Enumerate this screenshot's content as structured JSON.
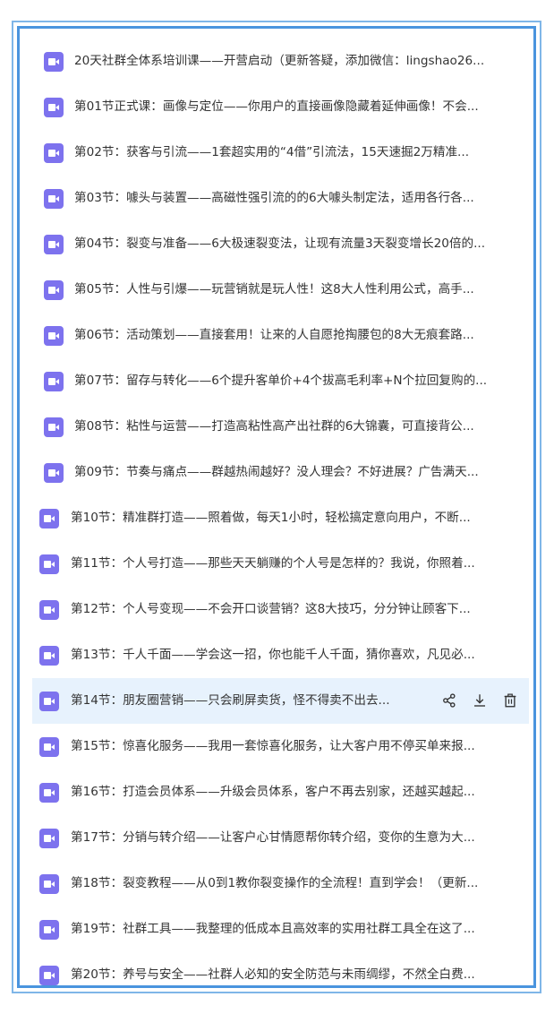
{
  "lessons": [
    {
      "title": "20天社群全体系培训课——开营启动（更新答疑，添加微信：lingshao26..."
    },
    {
      "title": "第01节正式课：画像与定位——你用户的直接画像隐藏着延伸画像！不会..."
    },
    {
      "title": "第02节：获客与引流——1套超实用的“4借”引流法，15天速掘2万精准..."
    },
    {
      "title": "第03节：噱头与装置——高磁性强引流的的6大噱头制定法，适用各行各..."
    },
    {
      "title": "第04节：裂变与准备——6大极速裂变法，让现有流量3天裂变增长20倍的..."
    },
    {
      "title": "第05节：人性与引爆——玩营销就是玩人性！这8大人性利用公式，高手..."
    },
    {
      "title": "第06节：活动策划——直接套用！让来的人自愿抢掏腰包的8大无痕套路..."
    },
    {
      "title": "第07节：留存与转化——6个提升客单价+4个拔高毛利率+N个拉回复购的..."
    },
    {
      "title": "第08节：粘性与运营——打造高粘性高产出社群的6大锦囊，可直接背公..."
    },
    {
      "title": "第09节：节奏与痛点——群越热闹越好？没人理会？不好进展？广告满天..."
    },
    {
      "title": "第10节：精准群打造——照着做，每天1小时，轻松搞定意向用户，不断..."
    },
    {
      "title": "第11节：个人号打造——那些天天躺赚的个人号是怎样的？我说，你照着..."
    },
    {
      "title": "第12节：个人号变现——不会开口谈营销？这8大技巧，分分钟让顾客下..."
    },
    {
      "title": "第13节：千人千面——学会这一招，你也能千人千面，猜你喜欢，凡见必..."
    },
    {
      "title": "第14节：朋友圈营销——只会刷屏卖货，怪不得卖不出去..."
    },
    {
      "title": "第15节：惊喜化服务——我用一套惊喜化服务，让大客户用不停买单来报..."
    },
    {
      "title": "第16节：打造会员体系——升级会员体系，客户不再去别家，还越买越起..."
    },
    {
      "title": "第17节：分销与转介绍——让客户心甘情愿帮你转介绍，变你的生意为大..."
    },
    {
      "title": "第18节：裂变教程——从0到1教你裂变操作的全流程！直到学会！（更新..."
    },
    {
      "title": "第19节：社群工具——我整理的低成本且高效率的实用社群工具全在这了..."
    },
    {
      "title": "第20节：养号与安全——社群人必知的安全防范与未雨绸缪，不然全白费..."
    }
  ],
  "actions": {
    "share_icon": "share-icon",
    "download_icon": "download-icon",
    "delete_icon": "trash-icon"
  },
  "colors": {
    "file_icon": "#7d72ee",
    "hover_bg": "#e7f2fd",
    "frame_inner": "#4a94de",
    "frame_outer": "#7fb6e8"
  }
}
